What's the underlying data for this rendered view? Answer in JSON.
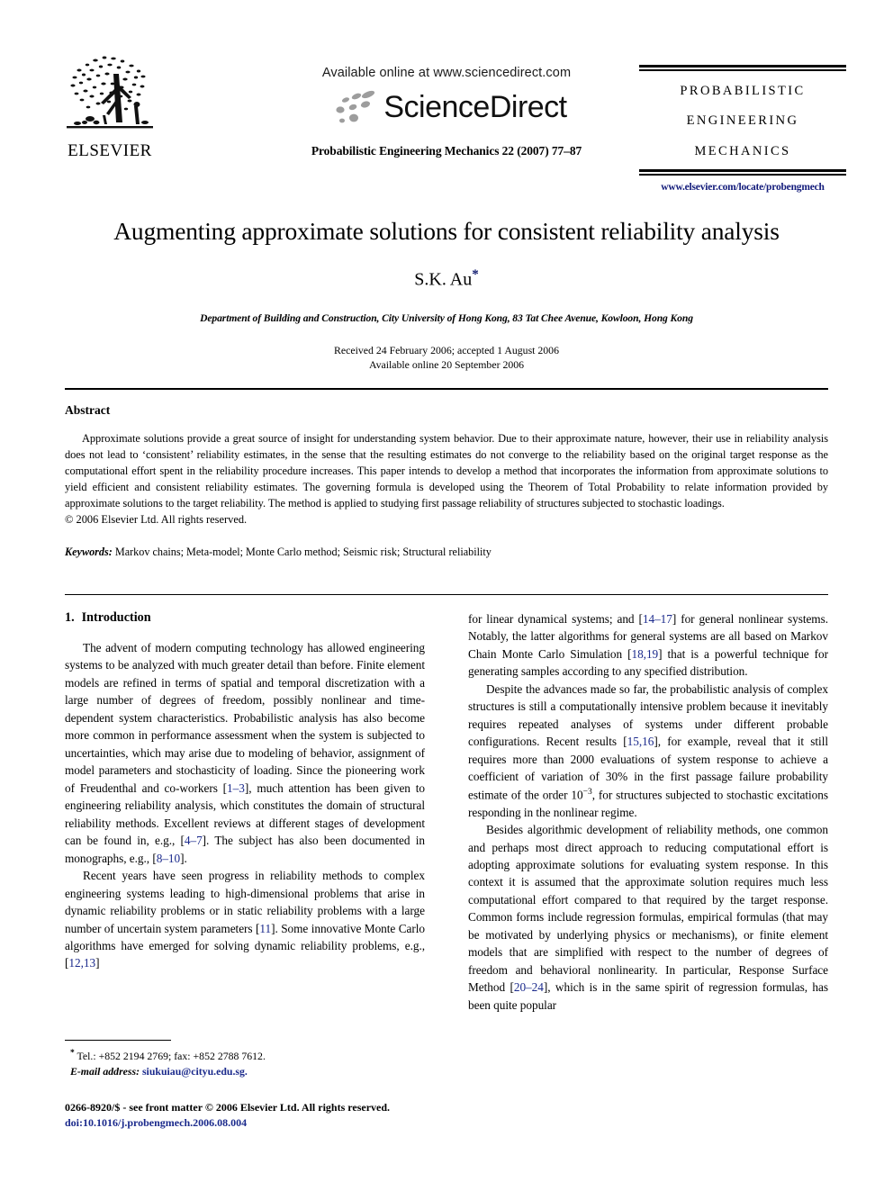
{
  "masthead": {
    "publisher_name": "ELSEVIER",
    "publisher_logo_icon": "elsevier-tree-logo",
    "available_online": "Available online at www.sciencedirect.com",
    "sciencedirect_wordmark": "ScienceDirect",
    "sciencedirect_dots_icon": "sciencedirect-dots-logo",
    "journal_citation": "Probabilistic Engineering Mechanics 22 (2007) 77–87",
    "journal_title_line1": "PROBABILISTIC",
    "journal_title_line2": "ENGINEERING",
    "journal_title_line3": "MECHANICS",
    "journal_url": "www.elsevier.com/locate/probengmech"
  },
  "title_block": {
    "title": "Augmenting approximate solutions for consistent reliability analysis",
    "author": "S.K. Au",
    "author_footnote_marker": "*",
    "affiliation": "Department of Building and Construction, City University of Hong Kong, 83 Tat Chee Avenue, Kowloon, Hong Kong",
    "received_line": "Received 24 February 2006; accepted 1 August 2006",
    "available_line": "Available online 20 September 2006"
  },
  "abstract": {
    "heading": "Abstract",
    "body": "Approximate solutions provide a great source of insight for understanding system behavior. Due to their approximate nature, however, their use in reliability analysis does not lead to ‘consistent’ reliability estimates, in the sense that the resulting estimates do not converge to the reliability based on the original target response as the computational effort spent in the reliability procedure increases. This paper intends to develop a method that incorporates the information from approximate solutions to yield efficient and consistent reliability estimates. The governing formula is developed using the Theorem of Total Probability to relate information provided by approximate solutions to the target reliability. The method is applied to studying first passage reliability of structures subjected to stochastic loadings.",
    "copyright": "© 2006 Elsevier Ltd. All rights reserved.",
    "keywords_label": "Keywords:",
    "keywords_value": "Markov chains; Meta-model; Monte Carlo method; Seismic risk; Structural reliability"
  },
  "body": {
    "section_number": "1.",
    "section_title": "Introduction",
    "left_column": [
      {
        "id": "para-1",
        "indent": true,
        "segments": [
          {
            "t": "The advent of modern computing technology has allowed engineering systems to be analyzed with much greater detail than before. Finite element models are refined in terms of spatial and temporal discretization with a large number of degrees of freedom, possibly nonlinear and time-dependent system characteristics. Probabilistic analysis has also become more common in performance assessment when the system is subjected to uncertainties, which may arise due to modeling of behavior, assignment of model parameters and stochasticity of loading. Since the pioneering work of Freudenthal and co-workers ["
          },
          {
            "t": "1–3",
            "ref": true
          },
          {
            "t": "], much attention has been given to engineering reliability analysis, which constitutes the domain of structural reliability methods. Excellent reviews at different stages of development can be found in, e.g., ["
          },
          {
            "t": "4–7",
            "ref": true
          },
          {
            "t": "]. The subject has also been documented in monographs, e.g., ["
          },
          {
            "t": "8–10",
            "ref": true
          },
          {
            "t": "]."
          }
        ]
      },
      {
        "id": "para-2",
        "indent": true,
        "segments": [
          {
            "t": "Recent years have seen progress in reliability methods to complex engineering systems leading to high-dimensional problems that arise in dynamic reliability problems or in static reliability problems with a large number of uncertain system parameters ["
          },
          {
            "t": "11",
            "ref": true
          },
          {
            "t": "]. Some innovative Monte Carlo algorithms have emerged for solving dynamic reliability problems, e.g., ["
          },
          {
            "t": "12,13",
            "ref": true
          },
          {
            "t": "]"
          }
        ]
      }
    ],
    "right_column": [
      {
        "id": "para-3",
        "indent": false,
        "segments": [
          {
            "t": "for linear dynamical systems; and ["
          },
          {
            "t": "14–17",
            "ref": true
          },
          {
            "t": "] for general nonlinear systems. Notably, the latter algorithms for general systems are all based on Markov Chain Monte Carlo Simulation ["
          },
          {
            "t": "18,19",
            "ref": true
          },
          {
            "t": "] that is a powerful technique for generating samples according to any specified distribution."
          }
        ]
      },
      {
        "id": "para-4",
        "indent": true,
        "segments": [
          {
            "t": "Despite the advances made so far, the probabilistic analysis of complex structures is still a computationally intensive problem because it inevitably requires repeated analyses of systems under different probable configurations. Recent results ["
          },
          {
            "t": "15,16",
            "ref": true
          },
          {
            "t": "], for example, reveal that it still requires more than 2000 evaluations of system response to achieve a coefficient of variation of 30% in the first passage failure probability estimate of the order 10"
          },
          {
            "t": "−3",
            "sup": true
          },
          {
            "t": ", for structures subjected to stochastic excitations responding in the nonlinear regime."
          }
        ]
      },
      {
        "id": "para-5",
        "indent": true,
        "segments": [
          {
            "t": "Besides algorithmic development of reliability methods, one common and perhaps most direct approach to reducing computational effort is adopting approximate solutions for evaluating system response. In this context it is assumed that the approximate solution requires much less computational effort compared to that required by the target response. Common forms include regression formulas, empirical formulas (that may be motivated by underlying physics or mechanisms), or finite element models that are simplified with respect to the number of degrees of freedom and behavioral nonlinearity. In particular, Response Surface Method ["
          },
          {
            "t": "20–24",
            "ref": true
          },
          {
            "t": "], which is in the same spirit of regression formulas, has been quite popular"
          }
        ]
      }
    ]
  },
  "footnotes": {
    "star": "*",
    "contact": "Tel.: +852 2194 2769; fax: +852 2788 7612.",
    "email_label": "E-mail address:",
    "email_value": "siukuiau@cityu.edu.sg."
  },
  "imprint": {
    "line1": "0266-8920/$ - see front matter © 2006 Elsevier Ltd. All rights reserved.",
    "doi": "doi:10.1016/j.probengmech.2006.08.004"
  },
  "colors": {
    "link": "#1b2a8c",
    "text": "#000000",
    "background": "#ffffff"
  }
}
